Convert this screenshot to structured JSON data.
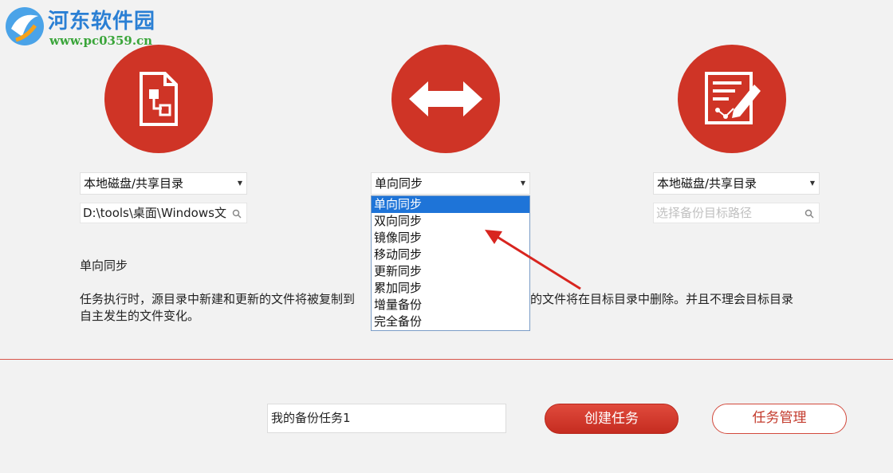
{
  "watermark": {
    "title": "河东软件园",
    "url": "www.pc0359.cn"
  },
  "icons": {
    "source": "file-diagram-icon",
    "mode": "double-arrow-icon",
    "target": "edit-document-icon",
    "accent": "#cf3426"
  },
  "source": {
    "type_selected": "本地磁盘/共享目录",
    "path_value": "D:\\tools\\桌面\\Windows文"
  },
  "mode": {
    "selected": "单向同步",
    "options": [
      "单向同步",
      "双向同步",
      "镜像同步",
      "移动同步",
      "更新同步",
      "累加同步",
      "增量备份",
      "完全备份"
    ]
  },
  "target": {
    "type_selected": "本地磁盘/共享目录",
    "path_placeholder": "选择备份目标路径"
  },
  "description": {
    "title": "单向同步",
    "line1_left": "任务执行时，源目录中新建和更新的文件将被复制到",
    "line1_right": "的文件将在目标目录中删除。并且不理会目标目录",
    "line2": "自主发生的文件变化。"
  },
  "task": {
    "name_value": "我的备份任务1",
    "create_label": "创建任务",
    "manage_label": "任务管理"
  }
}
